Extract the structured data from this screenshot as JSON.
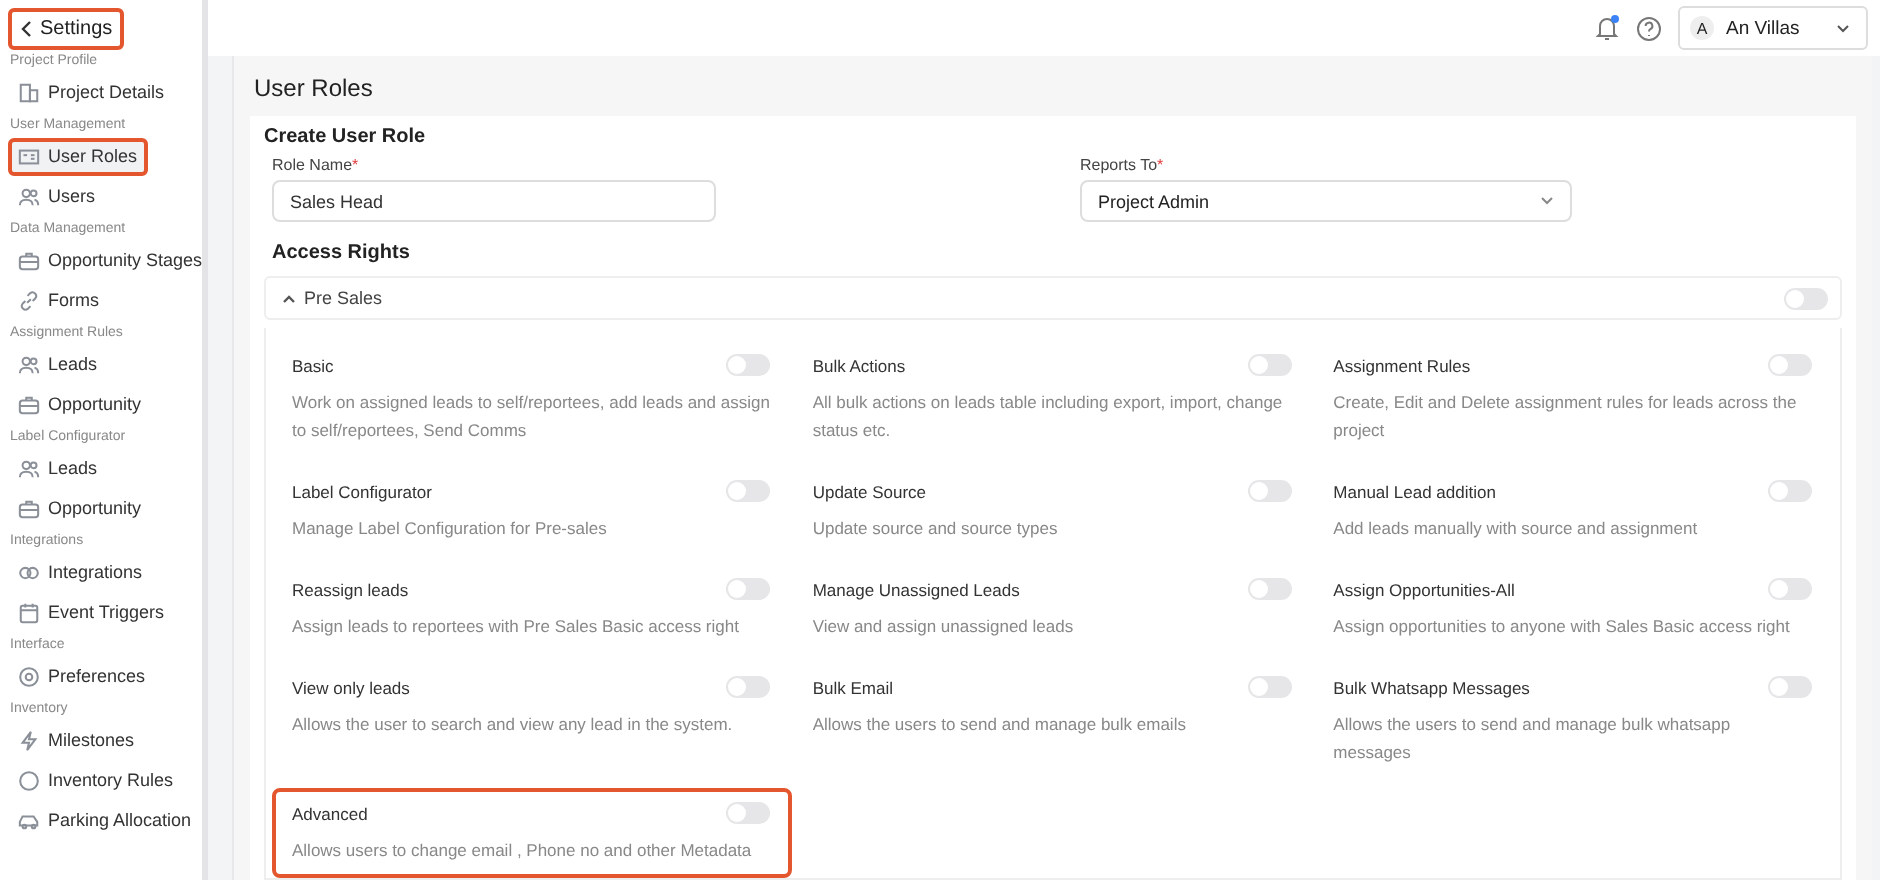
{
  "sidebar": {
    "back": {
      "label": "Settings",
      "highlighted": true
    },
    "sections": [
      {
        "title": "Project Profile",
        "items": [
          {
            "label": "Project Details",
            "kind": "building",
            "selected": false,
            "highlighted": false
          }
        ]
      },
      {
        "title": "User Management",
        "items": [
          {
            "label": "User Roles",
            "kind": "card",
            "selected": true,
            "highlighted": true
          },
          {
            "label": "Users",
            "kind": "people",
            "selected": false,
            "highlighted": false
          }
        ]
      },
      {
        "title": "Data Management",
        "items": [
          {
            "label": "Opportunity Stages",
            "kind": "case",
            "selected": false,
            "highlighted": false
          },
          {
            "label": "Forms",
            "kind": "link",
            "selected": false,
            "highlighted": false
          }
        ]
      },
      {
        "title": "Assignment Rules",
        "items": [
          {
            "label": "Leads",
            "kind": "people",
            "selected": false,
            "highlighted": false
          },
          {
            "label": "Opportunity",
            "kind": "case",
            "selected": false,
            "highlighted": false
          }
        ]
      },
      {
        "title": "Label Configurator",
        "items": [
          {
            "label": "Leads",
            "kind": "people",
            "selected": false,
            "highlighted": false
          },
          {
            "label": "Opportunity",
            "kind": "case",
            "selected": false,
            "highlighted": false
          }
        ]
      },
      {
        "title": "Integrations",
        "items": [
          {
            "label": "Integrations",
            "kind": "rings",
            "selected": false,
            "highlighted": false
          },
          {
            "label": "Event Triggers",
            "kind": "calendar",
            "selected": false,
            "highlighted": false
          }
        ]
      },
      {
        "title": "Interface",
        "items": [
          {
            "label": "Preferences",
            "kind": "target",
            "selected": false,
            "highlighted": false
          }
        ]
      },
      {
        "title": "Inventory",
        "items": [
          {
            "label": "Milestones",
            "kind": "bolt",
            "selected": false,
            "highlighted": false
          },
          {
            "label": "Inventory Rules",
            "kind": "circle",
            "selected": false,
            "highlighted": false
          },
          {
            "label": "Parking Allocation",
            "kind": "car",
            "selected": false,
            "highlighted": false
          }
        ]
      }
    ]
  },
  "topbar": {
    "notification": true,
    "user": {
      "initial": "A",
      "name": "An Villas"
    }
  },
  "page_title": "User Roles",
  "form": {
    "title": "Create User Role",
    "role_name": {
      "label": "Role Name",
      "required_mark": "*",
      "value": "Sales Head"
    },
    "reports_to": {
      "label": "Reports To",
      "required_mark": "*",
      "value": "Project Admin"
    }
  },
  "access_rights": {
    "title": "Access Rights",
    "group": {
      "label": "Pre Sales",
      "expanded": true,
      "on": false
    },
    "rights": [
      {
        "title": "Basic",
        "description": "Work on assigned leads to self/reportees, add leads and assign to self/reportees, Send Comms",
        "on": false,
        "highlighted": false
      },
      {
        "title": "Bulk Actions",
        "description": "All bulk actions on leads table including export, import, change status etc.",
        "on": false,
        "highlighted": false
      },
      {
        "title": "Assignment Rules",
        "description": "Create, Edit and Delete assignment rules for leads across the project",
        "on": false,
        "highlighted": false
      },
      {
        "title": "Label Configurator",
        "description": "Manage Label Configuration for Pre-sales",
        "on": false,
        "highlighted": false
      },
      {
        "title": "Update Source",
        "description": "Update source and source types",
        "on": false,
        "highlighted": false
      },
      {
        "title": "Manual Lead addition",
        "description": "Add leads manually with source and assignment",
        "on": false,
        "highlighted": false
      },
      {
        "title": "Reassign leads",
        "description": "Assign leads to reportees with Pre Sales Basic access right",
        "on": false,
        "highlighted": false
      },
      {
        "title": "Manage Unassigned Leads",
        "description": "View and assign unassigned leads",
        "on": false,
        "highlighted": false
      },
      {
        "title": "Assign Opportunities-All",
        "description": "Assign opportunities to anyone with Sales Basic access right",
        "on": false,
        "highlighted": false
      },
      {
        "title": "View only leads",
        "description": "Allows the user to search and view any lead in the system.",
        "on": false,
        "highlighted": false
      },
      {
        "title": "Bulk Email",
        "description": "Allows the users to send and manage bulk emails",
        "on": false,
        "highlighted": false
      },
      {
        "title": "Bulk Whatsapp Messages",
        "description": "Allows the users to send and manage bulk whatsapp messages",
        "on": false,
        "highlighted": false
      },
      {
        "title": "Advanced",
        "description": "Allows users to change email , Phone no and other Metadata",
        "on": false,
        "highlighted": true
      }
    ]
  }
}
